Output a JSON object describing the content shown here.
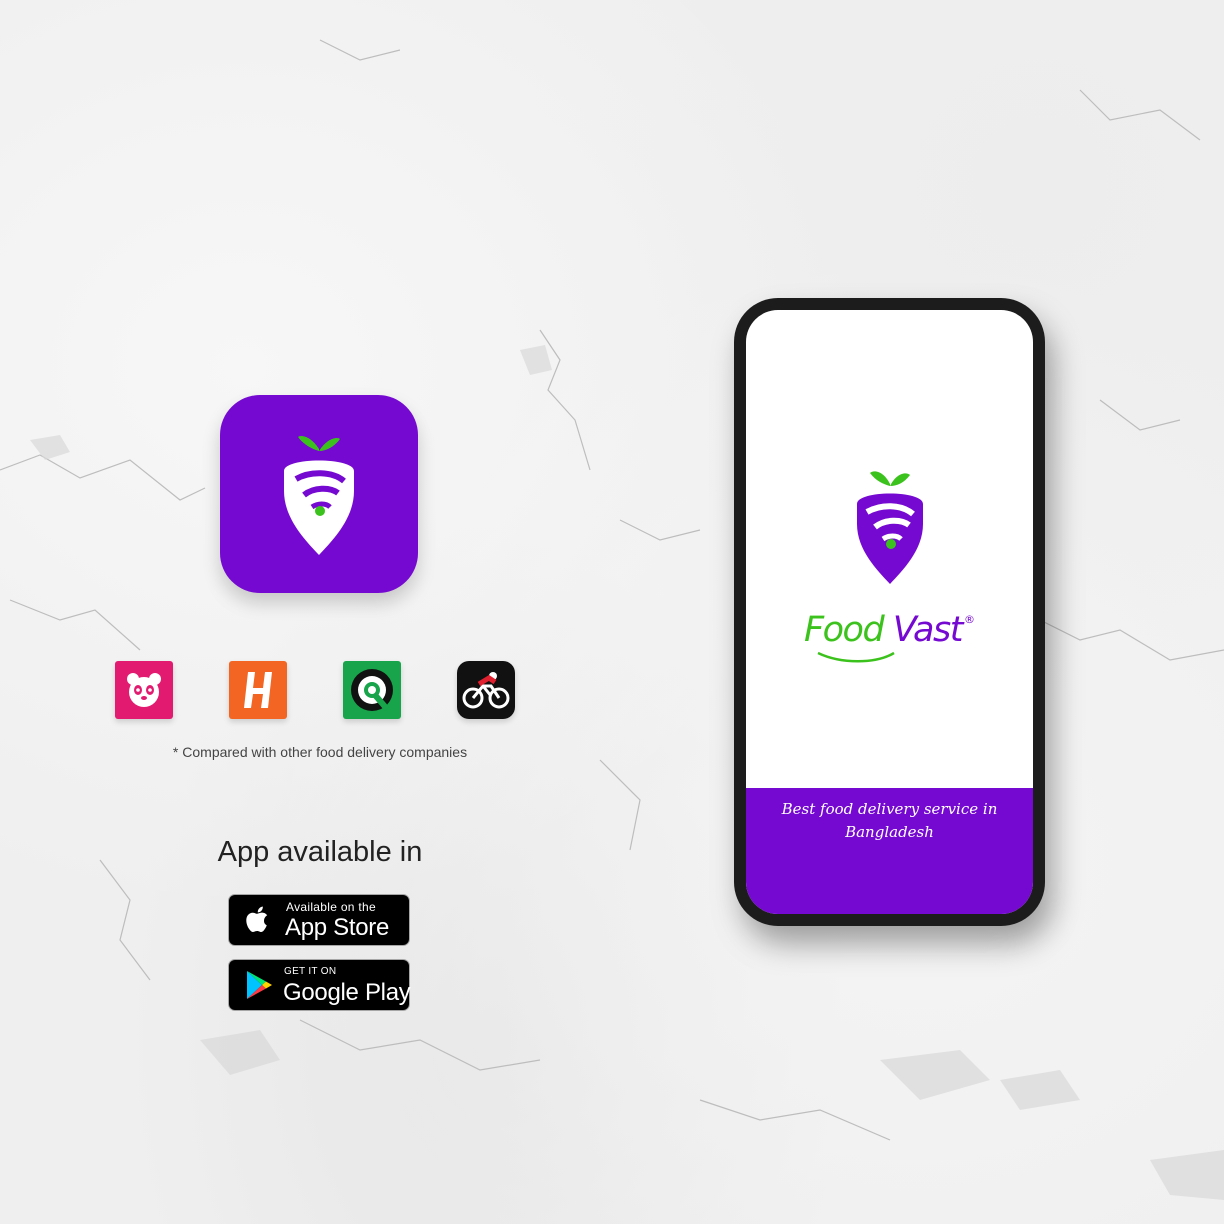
{
  "brand": {
    "name_part1": "Food",
    "name_part2": "Vast",
    "registered_mark": "®",
    "tagline": "Best food delivery service in Bangladesh",
    "logo_icon": "carrot-location-pin-icon"
  },
  "colors": {
    "brand_purple": "#7509d1",
    "brand_green": "#3cc21c",
    "foodpanda_pink": "#e21b70",
    "hungrynaki_orange": "#f26522",
    "pathao_green": "#17a44a",
    "bike_black": "#111111"
  },
  "competitors": {
    "icons": [
      "panda-icon",
      "h-letter-icon",
      "q-circle-icon",
      "cyclist-icon"
    ],
    "note": "Compared with other food delivery companies"
  },
  "availability": {
    "title": "App available in",
    "app_store": {
      "small": "Available on the",
      "big": "App Store",
      "icon": "apple-icon"
    },
    "google_play": {
      "small": "GET IT ON",
      "big": "Google Play",
      "icon": "play-triangle-icon"
    }
  }
}
